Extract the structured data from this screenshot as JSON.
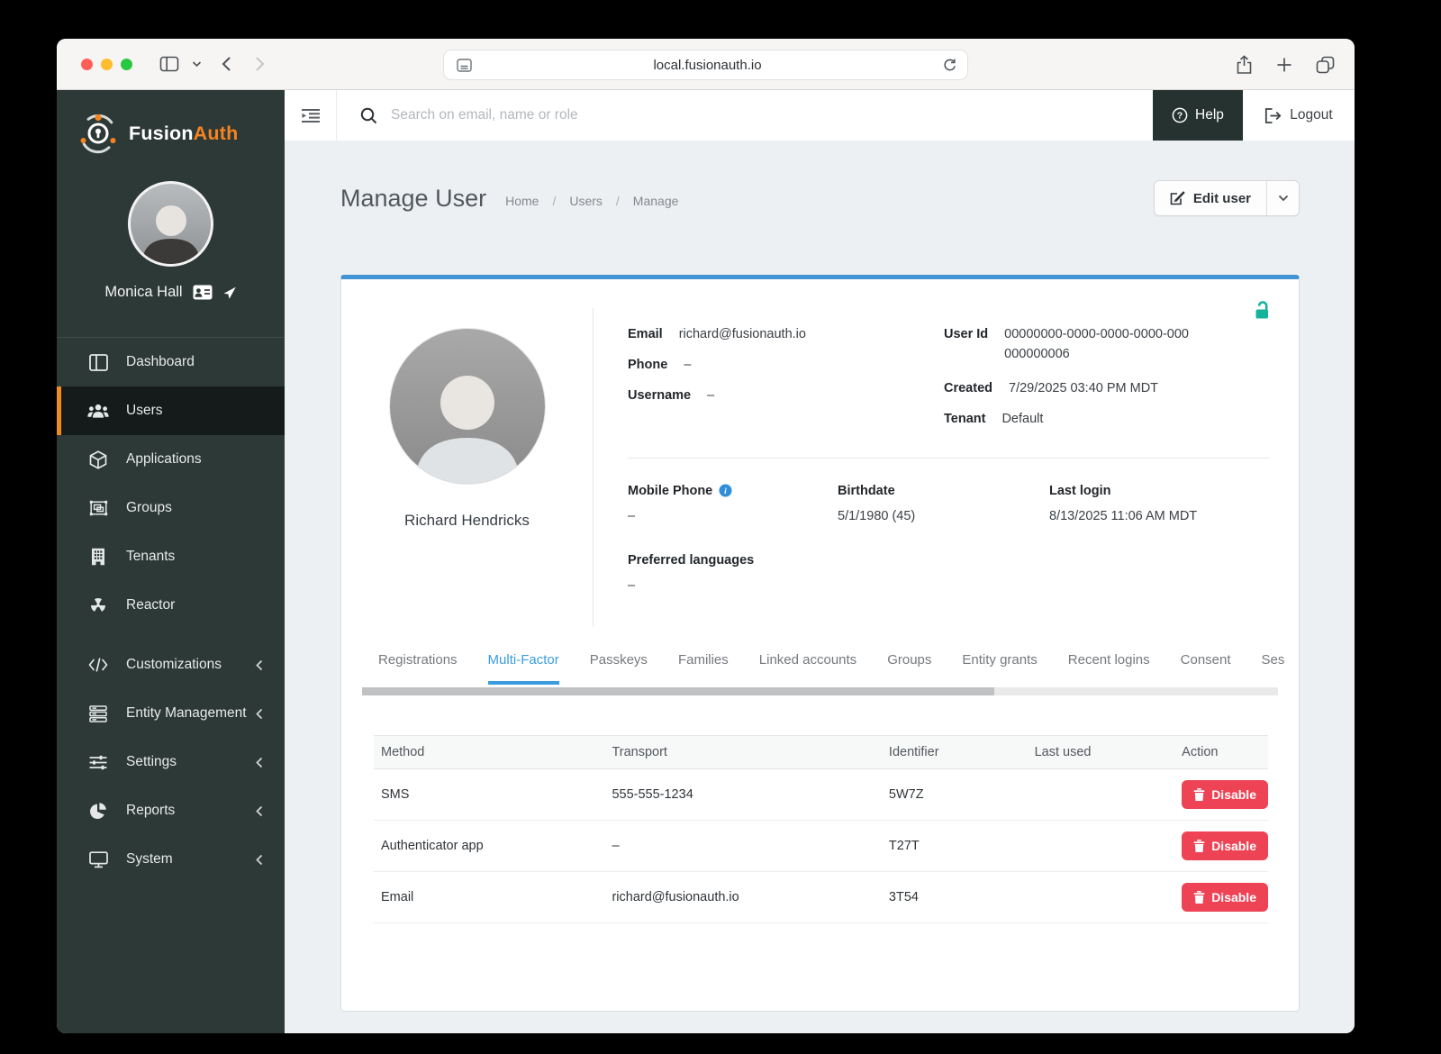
{
  "colors": {
    "accent_orange": "#F58320",
    "sidebar_bg": "#2D3937",
    "card_top_blue": "#4294D5",
    "tab_active_blue": "#3B9DDE",
    "danger_red": "#EE4355",
    "lock_teal": "#14B39A"
  },
  "browser": {
    "url": "local.fusionauth.io"
  },
  "sidebar": {
    "brand_fusion": "Fusion",
    "brand_auth": "Auth",
    "user_name": "Monica Hall",
    "nav": [
      {
        "label": "Dashboard"
      },
      {
        "label": "Users"
      },
      {
        "label": "Applications"
      },
      {
        "label": "Groups"
      },
      {
        "label": "Tenants"
      },
      {
        "label": "Reactor"
      }
    ],
    "groups": [
      {
        "label": "Customizations"
      },
      {
        "label": "Entity Management"
      },
      {
        "label": "Settings"
      },
      {
        "label": "Reports"
      },
      {
        "label": "System"
      }
    ]
  },
  "topbar": {
    "search_placeholder": "Search on email, name or role",
    "help_label": "Help",
    "logout_label": "Logout"
  },
  "page": {
    "title": "Manage User",
    "breadcrumb": [
      "Home",
      "Users",
      "Manage"
    ],
    "breadcrumb_separator": "/",
    "edit_user_label": "Edit user"
  },
  "profile": {
    "name": "Richard Hendricks",
    "fields_left": [
      {
        "label": "Email",
        "value": "richard@fusionauth.io"
      },
      {
        "label": "Phone",
        "value": "–"
      },
      {
        "label": "Username",
        "value": "–"
      }
    ],
    "fields_right": [
      {
        "label": "User Id",
        "value": "00000000-0000-0000-0000-000000000006"
      },
      {
        "label": "Created",
        "value": "7/29/2025 03:40 PM MDT"
      },
      {
        "label": "Tenant",
        "value": "Default"
      }
    ],
    "details": [
      {
        "label": "Mobile Phone",
        "value": "–"
      },
      {
        "label": "Birthdate",
        "value": "5/1/1980 (45)"
      },
      {
        "label": "Last login",
        "value": "8/13/2025 11:06 AM MDT"
      }
    ],
    "preferred_languages": {
      "label": "Preferred languages",
      "value": "–"
    }
  },
  "tabs": [
    {
      "label": "Registrations"
    },
    {
      "label": "Multi-Factor"
    },
    {
      "label": "Passkeys"
    },
    {
      "label": "Families"
    },
    {
      "label": "Linked accounts"
    },
    {
      "label": "Groups"
    },
    {
      "label": "Entity grants"
    },
    {
      "label": "Recent logins"
    },
    {
      "label": "Consent"
    },
    {
      "label": "Ses"
    }
  ],
  "mfa_table": {
    "columns": [
      "Method",
      "Transport",
      "Identifier",
      "Last used",
      "Action"
    ],
    "rows": [
      {
        "method": "SMS",
        "transport": "555-555-1234",
        "identifier": "5W7Z",
        "last_used": "",
        "action": "Disable"
      },
      {
        "method": "Authenticator app",
        "transport": "–",
        "identifier": "T27T",
        "last_used": "",
        "action": "Disable"
      },
      {
        "method": "Email",
        "transport": "richard@fusionauth.io",
        "identifier": "3T54",
        "last_used": "",
        "action": "Disable"
      }
    ]
  }
}
